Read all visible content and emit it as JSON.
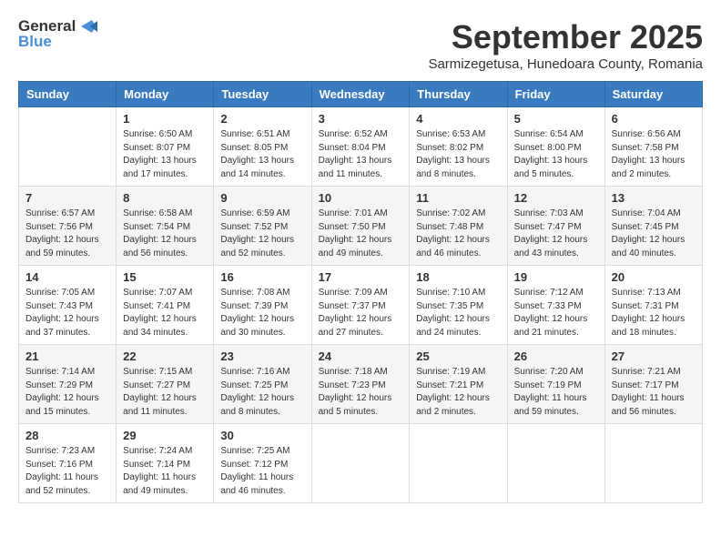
{
  "logo": {
    "general": "General",
    "blue": "Blue"
  },
  "title": "September 2025",
  "subtitle": "Sarmizegetusa, Hunedoara County, Romania",
  "headers": [
    "Sunday",
    "Monday",
    "Tuesday",
    "Wednesday",
    "Thursday",
    "Friday",
    "Saturday"
  ],
  "weeks": [
    [
      {
        "day": "",
        "sunrise": "",
        "sunset": "",
        "daylight": ""
      },
      {
        "day": "1",
        "sunrise": "Sunrise: 6:50 AM",
        "sunset": "Sunset: 8:07 PM",
        "daylight": "Daylight: 13 hours and 17 minutes."
      },
      {
        "day": "2",
        "sunrise": "Sunrise: 6:51 AM",
        "sunset": "Sunset: 8:05 PM",
        "daylight": "Daylight: 13 hours and 14 minutes."
      },
      {
        "day": "3",
        "sunrise": "Sunrise: 6:52 AM",
        "sunset": "Sunset: 8:04 PM",
        "daylight": "Daylight: 13 hours and 11 minutes."
      },
      {
        "day": "4",
        "sunrise": "Sunrise: 6:53 AM",
        "sunset": "Sunset: 8:02 PM",
        "daylight": "Daylight: 13 hours and 8 minutes."
      },
      {
        "day": "5",
        "sunrise": "Sunrise: 6:54 AM",
        "sunset": "Sunset: 8:00 PM",
        "daylight": "Daylight: 13 hours and 5 minutes."
      },
      {
        "day": "6",
        "sunrise": "Sunrise: 6:56 AM",
        "sunset": "Sunset: 7:58 PM",
        "daylight": "Daylight: 13 hours and 2 minutes."
      }
    ],
    [
      {
        "day": "7",
        "sunrise": "Sunrise: 6:57 AM",
        "sunset": "Sunset: 7:56 PM",
        "daylight": "Daylight: 12 hours and 59 minutes."
      },
      {
        "day": "8",
        "sunrise": "Sunrise: 6:58 AM",
        "sunset": "Sunset: 7:54 PM",
        "daylight": "Daylight: 12 hours and 56 minutes."
      },
      {
        "day": "9",
        "sunrise": "Sunrise: 6:59 AM",
        "sunset": "Sunset: 7:52 PM",
        "daylight": "Daylight: 12 hours and 52 minutes."
      },
      {
        "day": "10",
        "sunrise": "Sunrise: 7:01 AM",
        "sunset": "Sunset: 7:50 PM",
        "daylight": "Daylight: 12 hours and 49 minutes."
      },
      {
        "day": "11",
        "sunrise": "Sunrise: 7:02 AM",
        "sunset": "Sunset: 7:48 PM",
        "daylight": "Daylight: 12 hours and 46 minutes."
      },
      {
        "day": "12",
        "sunrise": "Sunrise: 7:03 AM",
        "sunset": "Sunset: 7:47 PM",
        "daylight": "Daylight: 12 hours and 43 minutes."
      },
      {
        "day": "13",
        "sunrise": "Sunrise: 7:04 AM",
        "sunset": "Sunset: 7:45 PM",
        "daylight": "Daylight: 12 hours and 40 minutes."
      }
    ],
    [
      {
        "day": "14",
        "sunrise": "Sunrise: 7:05 AM",
        "sunset": "Sunset: 7:43 PM",
        "daylight": "Daylight: 12 hours and 37 minutes."
      },
      {
        "day": "15",
        "sunrise": "Sunrise: 7:07 AM",
        "sunset": "Sunset: 7:41 PM",
        "daylight": "Daylight: 12 hours and 34 minutes."
      },
      {
        "day": "16",
        "sunrise": "Sunrise: 7:08 AM",
        "sunset": "Sunset: 7:39 PM",
        "daylight": "Daylight: 12 hours and 30 minutes."
      },
      {
        "day": "17",
        "sunrise": "Sunrise: 7:09 AM",
        "sunset": "Sunset: 7:37 PM",
        "daylight": "Daylight: 12 hours and 27 minutes."
      },
      {
        "day": "18",
        "sunrise": "Sunrise: 7:10 AM",
        "sunset": "Sunset: 7:35 PM",
        "daylight": "Daylight: 12 hours and 24 minutes."
      },
      {
        "day": "19",
        "sunrise": "Sunrise: 7:12 AM",
        "sunset": "Sunset: 7:33 PM",
        "daylight": "Daylight: 12 hours and 21 minutes."
      },
      {
        "day": "20",
        "sunrise": "Sunrise: 7:13 AM",
        "sunset": "Sunset: 7:31 PM",
        "daylight": "Daylight: 12 hours and 18 minutes."
      }
    ],
    [
      {
        "day": "21",
        "sunrise": "Sunrise: 7:14 AM",
        "sunset": "Sunset: 7:29 PM",
        "daylight": "Daylight: 12 hours and 15 minutes."
      },
      {
        "day": "22",
        "sunrise": "Sunrise: 7:15 AM",
        "sunset": "Sunset: 7:27 PM",
        "daylight": "Daylight: 12 hours and 11 minutes."
      },
      {
        "day": "23",
        "sunrise": "Sunrise: 7:16 AM",
        "sunset": "Sunset: 7:25 PM",
        "daylight": "Daylight: 12 hours and 8 minutes."
      },
      {
        "day": "24",
        "sunrise": "Sunrise: 7:18 AM",
        "sunset": "Sunset: 7:23 PM",
        "daylight": "Daylight: 12 hours and 5 minutes."
      },
      {
        "day": "25",
        "sunrise": "Sunrise: 7:19 AM",
        "sunset": "Sunset: 7:21 PM",
        "daylight": "Daylight: 12 hours and 2 minutes."
      },
      {
        "day": "26",
        "sunrise": "Sunrise: 7:20 AM",
        "sunset": "Sunset: 7:19 PM",
        "daylight": "Daylight: 11 hours and 59 minutes."
      },
      {
        "day": "27",
        "sunrise": "Sunrise: 7:21 AM",
        "sunset": "Sunset: 7:17 PM",
        "daylight": "Daylight: 11 hours and 56 minutes."
      }
    ],
    [
      {
        "day": "28",
        "sunrise": "Sunrise: 7:23 AM",
        "sunset": "Sunset: 7:16 PM",
        "daylight": "Daylight: 11 hours and 52 minutes."
      },
      {
        "day": "29",
        "sunrise": "Sunrise: 7:24 AM",
        "sunset": "Sunset: 7:14 PM",
        "daylight": "Daylight: 11 hours and 49 minutes."
      },
      {
        "day": "30",
        "sunrise": "Sunrise: 7:25 AM",
        "sunset": "Sunset: 7:12 PM",
        "daylight": "Daylight: 11 hours and 46 minutes."
      },
      {
        "day": "",
        "sunrise": "",
        "sunset": "",
        "daylight": ""
      },
      {
        "day": "",
        "sunrise": "",
        "sunset": "",
        "daylight": ""
      },
      {
        "day": "",
        "sunrise": "",
        "sunset": "",
        "daylight": ""
      },
      {
        "day": "",
        "sunrise": "",
        "sunset": "",
        "daylight": ""
      }
    ]
  ]
}
